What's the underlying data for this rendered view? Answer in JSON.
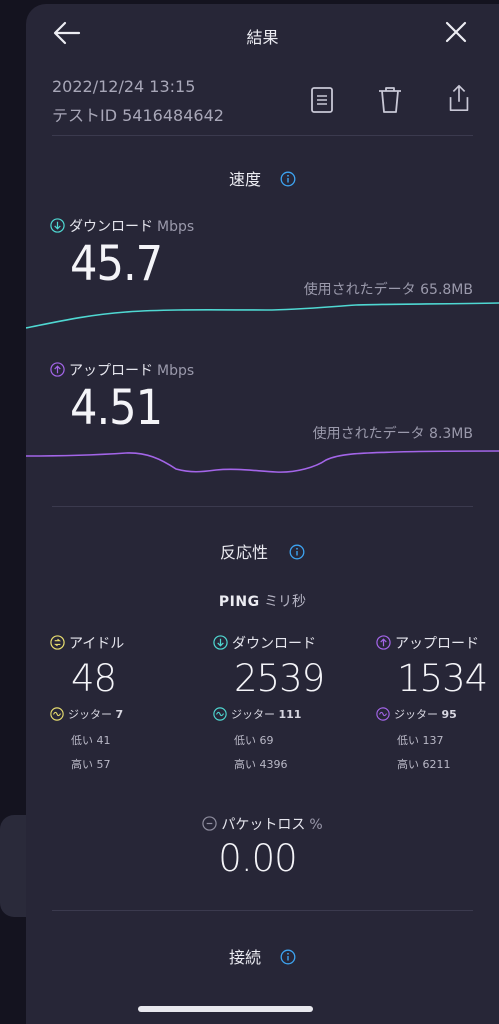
{
  "header": {
    "title": "結果"
  },
  "meta": {
    "datetime": "2022/12/24 13:15",
    "test_id": "テストID 5416484642"
  },
  "toolbar": {
    "icons": [
      "document-icon",
      "trash-icon",
      "share-icon"
    ]
  },
  "speed": {
    "section_title": "速度",
    "download": {
      "label": "ダウンロード",
      "unit": "Mbps",
      "value": "45.7",
      "data_used": "使用されたデータ 65.8MB",
      "color": "#4fd8d2"
    },
    "upload": {
      "label": "アップロード",
      "unit": "Mbps",
      "value": "4.51",
      "data_used": "使用されたデータ 8.3MB",
      "color": "#a365e8"
    }
  },
  "responsiveness": {
    "section_title": "反応性",
    "ping_label": "PING",
    "ping_unit": "ミリ秒",
    "columns": [
      {
        "label": "アイドル",
        "value": "48",
        "jitter_label": "ジッター",
        "jitter": "7",
        "low": "低い 41",
        "high": "高い 57",
        "color": "#e7dc6f"
      },
      {
        "label": "ダウンロード",
        "value": "2539",
        "jitter_label": "ジッター",
        "jitter": "111",
        "low": "低い 69",
        "high": "高い 4396",
        "color": "#4fd8d2"
      },
      {
        "label": "アップロード",
        "value": "1534",
        "jitter_label": "ジッター",
        "jitter": "95",
        "low": "低い 137",
        "high": "高い 6211",
        "color": "#a365e8"
      }
    ],
    "packet_loss": {
      "label": "パケットロス",
      "unit": "%",
      "value": "0.00"
    }
  },
  "connection": {
    "section_title": "接続"
  },
  "colors": {
    "accent_info": "#3da3f0",
    "background": "#272637"
  }
}
